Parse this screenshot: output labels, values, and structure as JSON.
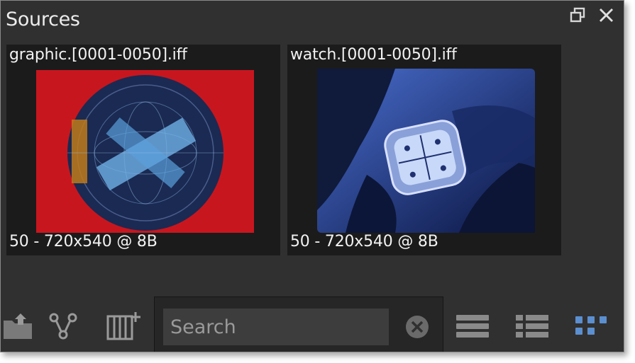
{
  "panel": {
    "title": "Sources"
  },
  "window_buttons": {
    "float_icon": "restore-window-icon",
    "close_icon": "close-icon"
  },
  "sources": [
    {
      "name": "graphic.[0001-0050].iff",
      "info": "50 - 720x540 @ 8B"
    },
    {
      "name": "watch.[0001-0050].iff",
      "info": "50 - 720x540 @ 8B"
    }
  ],
  "toolbar": {
    "left_icons": [
      "import-folder-icon",
      "graph-nodes-icon",
      "add-clip-icon"
    ],
    "search_placeholder": "Search",
    "search_value": "",
    "clear_icon": "clear-search-icon",
    "view_icons": [
      "list-view-icon",
      "detail-list-view-icon",
      "thumbnail-view-icon"
    ],
    "active_view": "thumbnail-view-icon"
  },
  "colors": {
    "panel_bg": "#303030",
    "thumb_bg": "#1b1b1b",
    "active_icon": "#5b8fd0",
    "icon": "#8a8a8a"
  }
}
